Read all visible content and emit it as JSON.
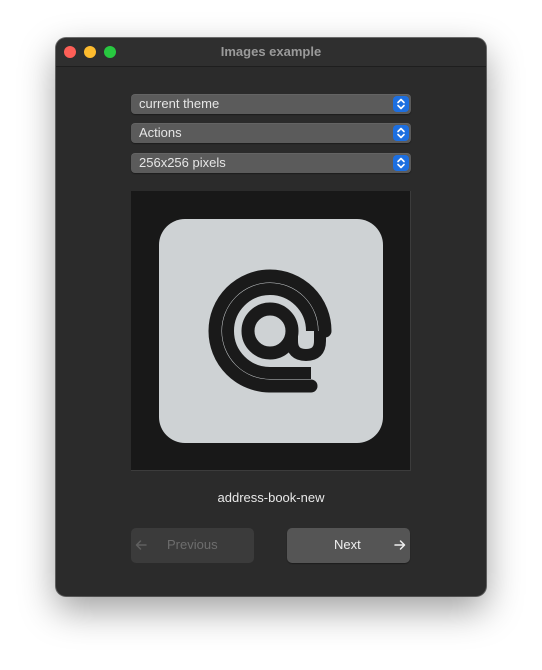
{
  "window": {
    "title": "Images example"
  },
  "combos": {
    "theme": {
      "selected": "current theme"
    },
    "context": {
      "selected": "Actions"
    },
    "size": {
      "selected": "256x256 pixels"
    }
  },
  "preview": {
    "icon": "at-sign-icon",
    "icon_name": "address-book-new"
  },
  "buttons": {
    "previous": {
      "label": "Previous",
      "enabled": false,
      "icon": "arrow-left-icon"
    },
    "next": {
      "label": "Next",
      "enabled": true,
      "icon": "arrow-right-icon"
    }
  },
  "colors": {
    "window_bg": "#2b2b2b",
    "accent": "#1d6fe0",
    "icon_tile": "#ced2d4",
    "icon_glyph": "#1a1a1a"
  }
}
